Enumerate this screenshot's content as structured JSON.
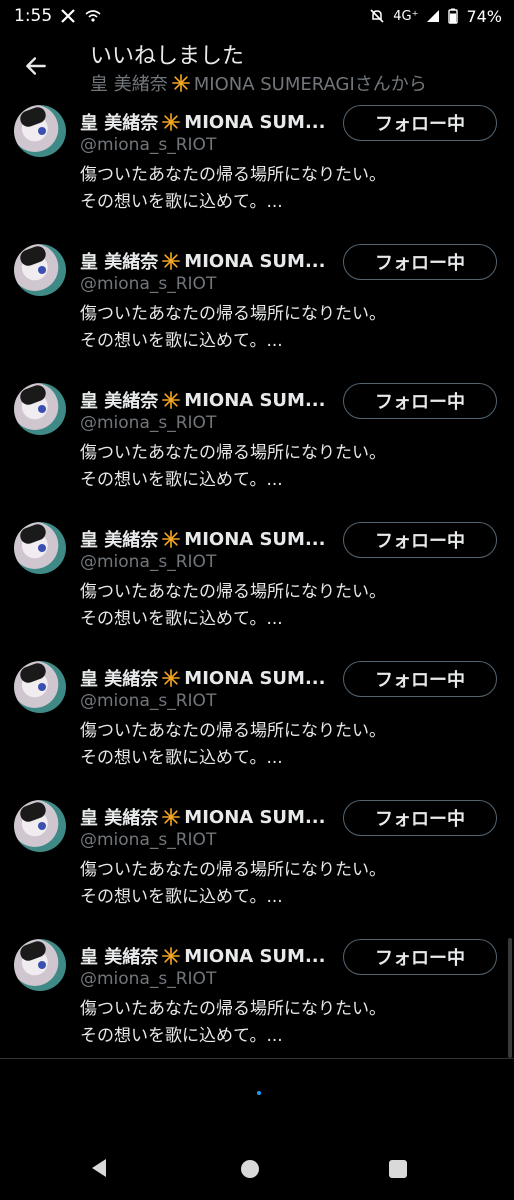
{
  "status_bar": {
    "time": "1:55",
    "network": "4G⁺",
    "battery": "74%",
    "icons": [
      "x-logo-icon",
      "wifi-calling-icon",
      "mute-icon",
      "signal-icon",
      "battery-icon"
    ]
  },
  "header": {
    "title": "いいねしました",
    "subtitle_name": "皇 美緒奈",
    "subtitle_rest": "MIONA SUMERAGIさんから",
    "back_icon": "back-arrow-icon"
  },
  "users": [
    {
      "name": "皇 美緒奈",
      "name_rest": "MIONA SUM...",
      "handle": "@miona_s_RIOT",
      "bio_line1": "傷ついたあなたの帰る場所になりたい。",
      "bio_line2": "その想いを歌に込めて。...",
      "button": "フォロー中"
    },
    {
      "name": "皇 美緒奈",
      "name_rest": "MIONA SUM...",
      "handle": "@miona_s_RIOT",
      "bio_line1": "傷ついたあなたの帰る場所になりたい。",
      "bio_line2": "その想いを歌に込めて。...",
      "button": "フォロー中"
    },
    {
      "name": "皇 美緒奈",
      "name_rest": "MIONA SUM...",
      "handle": "@miona_s_RIOT",
      "bio_line1": "傷ついたあなたの帰る場所になりたい。",
      "bio_line2": "その想いを歌に込めて。...",
      "button": "フォロー中"
    },
    {
      "name": "皇 美緒奈",
      "name_rest": "MIONA SUM...",
      "handle": "@miona_s_RIOT",
      "bio_line1": "傷ついたあなたの帰る場所になりたい。",
      "bio_line2": "その想いを歌に込めて。...",
      "button": "フォロー中"
    },
    {
      "name": "皇 美緒奈",
      "name_rest": "MIONA SUM...",
      "handle": "@miona_s_RIOT",
      "bio_line1": "傷ついたあなたの帰る場所になりたい。",
      "bio_line2": "その想いを歌に込めて。...",
      "button": "フォロー中"
    },
    {
      "name": "皇 美緒奈",
      "name_rest": "MIONA SUM...",
      "handle": "@miona_s_RIOT",
      "bio_line1": "傷ついたあなたの帰る場所になりたい。",
      "bio_line2": "その想いを歌に込めて。...",
      "button": "フォロー中"
    },
    {
      "name": "皇 美緒奈",
      "name_rest": "MIONA SUM...",
      "handle": "@miona_s_RIOT",
      "bio_line1": "傷ついたあなたの帰る場所になりたい。",
      "bio_line2": "その想いを歌に込めて。...",
      "button": "フォロー中"
    }
  ],
  "colors": {
    "background": "#000000",
    "text_primary": "#e7e9ea",
    "text_secondary": "#71767b",
    "sparkle": "#f5a623",
    "button_border": "#536471",
    "loading": "#1d9bf0"
  },
  "nav": {
    "icons": [
      "nav-back-icon",
      "nav-home-icon",
      "nav-recent-apps-icon"
    ]
  }
}
